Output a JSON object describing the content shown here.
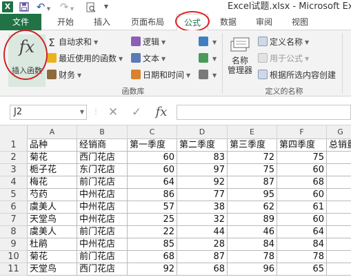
{
  "window": {
    "title": "Excel试题.xlsx - Microsoft Excel",
    "app_logo": "X"
  },
  "quick_access": {
    "save_icon": "save-icon",
    "undo_glyph": "↶",
    "redo_glyph": "↷",
    "print_preview_icon": "print-preview-icon"
  },
  "tabs": [
    {
      "label": "文件"
    },
    {
      "label": "开始"
    },
    {
      "label": "插入"
    },
    {
      "label": "页面布局"
    },
    {
      "label": "公式"
    },
    {
      "label": "数据"
    },
    {
      "label": "审阅"
    },
    {
      "label": "视图"
    }
  ],
  "ribbon": {
    "insert_function": {
      "glyph": "fx",
      "label": "插入函数"
    },
    "function_library": {
      "group_label": "函数库",
      "items": [
        {
          "label": "自动求和",
          "icon": "sigma-icon"
        },
        {
          "label": "最近使用的函数",
          "icon": "star-icon"
        },
        {
          "label": "财务",
          "icon": "finance-icon"
        },
        {
          "label": "逻辑",
          "icon": "logic-icon"
        },
        {
          "label": "文本",
          "icon": "text-icon"
        },
        {
          "label": "日期和时间",
          "icon": "datetime-icon"
        }
      ],
      "small_icons": [
        "lookup-icon",
        "math-icon",
        "more-functions-icon"
      ]
    },
    "defined_names": {
      "group_label": "定义的名称",
      "name_manager": {
        "label_line1": "名称",
        "label_line2": "管理器"
      },
      "items": [
        {
          "label": "定义名称"
        },
        {
          "label": "用于公式"
        },
        {
          "label": "根据所选内容创建"
        }
      ]
    }
  },
  "formula_bar": {
    "name_box": "J2",
    "cancel_glyph": "✕",
    "enter_glyph": "✓",
    "fx_glyph": "fx",
    "value": ""
  },
  "sheet": {
    "columns": [
      "A",
      "B",
      "C",
      "D",
      "E",
      "F",
      "G"
    ],
    "rows": [
      {
        "n": "1",
        "cells": [
          "品种",
          "经销商",
          "第一季度",
          "第二季度",
          "第三季度",
          "第四季度",
          "总销量"
        ]
      },
      {
        "n": "2",
        "cells": [
          "菊花",
          "西门花店",
          "60",
          "83",
          "72",
          "75",
          ""
        ]
      },
      {
        "n": "3",
        "cells": [
          "栀子花",
          "东门花店",
          "60",
          "97",
          "75",
          "60",
          ""
        ]
      },
      {
        "n": "4",
        "cells": [
          "梅花",
          "前门花店",
          "64",
          "92",
          "87",
          "68",
          ""
        ]
      },
      {
        "n": "5",
        "cells": [
          "芍药",
          "中州花店",
          "86",
          "77",
          "95",
          "60",
          ""
        ]
      },
      {
        "n": "6",
        "cells": [
          "虞美人",
          "中州花店",
          "57",
          "38",
          "62",
          "61",
          ""
        ]
      },
      {
        "n": "7",
        "cells": [
          "天堂鸟",
          "中州花店",
          "25",
          "32",
          "89",
          "60",
          ""
        ]
      },
      {
        "n": "8",
        "cells": [
          "虞美人",
          "前门花店",
          "22",
          "44",
          "46",
          "64",
          ""
        ]
      },
      {
        "n": "9",
        "cells": [
          "杜鹃",
          "中州花店",
          "85",
          "28",
          "84",
          "84",
          ""
        ]
      },
      {
        "n": "10",
        "cells": [
          "菊花",
          "前门花店",
          "68",
          "87",
          "78",
          "78",
          ""
        ]
      },
      {
        "n": "11",
        "cells": [
          "天堂鸟",
          "西门花店",
          "92",
          "68",
          "96",
          "65",
          ""
        ]
      }
    ]
  },
  "colors": {
    "accent": "#217346",
    "highlight_circle": "#d22222"
  }
}
